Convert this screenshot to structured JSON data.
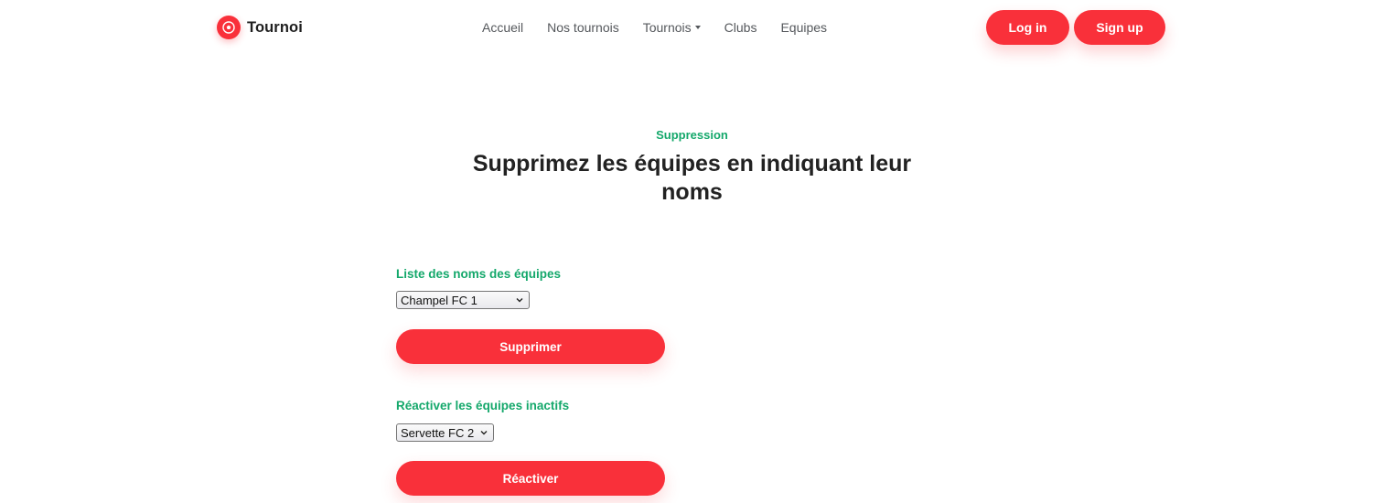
{
  "navbar": {
    "brand": "Tournoi",
    "links": [
      {
        "label": "Accueil"
      },
      {
        "label": "Nos tournois"
      },
      {
        "label": "Tournois",
        "has_dropdown": true
      },
      {
        "label": "Clubs"
      },
      {
        "label": "Equipes"
      }
    ],
    "login_label": "Log in",
    "signup_label": "Sign up"
  },
  "header": {
    "eyebrow": "Suppression",
    "title": "Supprimez les équipes en indiquant leur noms"
  },
  "delete_form": {
    "label": "Liste des noms des équipes",
    "selected": "Champel FC 1",
    "button_label": "Supprimer"
  },
  "reactivate_form": {
    "label": "Réactiver les équipes inactifs",
    "selected": "Servette FC 2",
    "button_label": "Réactiver"
  },
  "icons": {
    "brand_logo": "soccer-ball-icon",
    "dropdown_caret": "caret-down-icon",
    "select_chevron": "chevron-down-icon"
  },
  "colors": {
    "accent": "#f9303a",
    "eyebrow_green": "#14a86b",
    "heading": "#222222",
    "nav_text": "#55585c"
  }
}
